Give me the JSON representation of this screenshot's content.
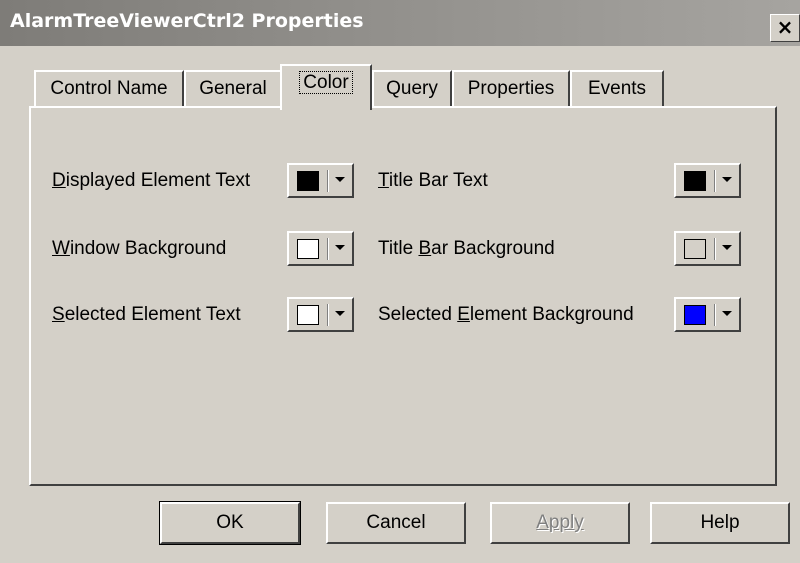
{
  "window": {
    "title": "AlarmTreeViewerCtrl2 Properties",
    "close_glyph": "×"
  },
  "tabs": [
    {
      "label": "Control Name",
      "active": false
    },
    {
      "label": "General",
      "active": false
    },
    {
      "label": "Color",
      "active": true
    },
    {
      "label": "Query",
      "active": false
    },
    {
      "label": "Properties",
      "active": false
    },
    {
      "label": "Events",
      "active": false
    }
  ],
  "colors": {
    "displayed_element_text": {
      "label_prefix": "",
      "label_mnemonic": "D",
      "label_rest": "isplayed Element Text",
      "color": "#000000"
    },
    "title_bar_text": {
      "label_prefix": "",
      "label_mnemonic": "T",
      "label_rest": "itle Bar Text",
      "color": "#000000"
    },
    "window_background": {
      "label_prefix": "",
      "label_mnemonic": "W",
      "label_rest": "indow Background",
      "color": "#ffffff"
    },
    "title_bar_background": {
      "label_prefix": "Title ",
      "label_mnemonic": "B",
      "label_rest": "ar Background",
      "color": "#d4d0c8"
    },
    "selected_element_text": {
      "label_prefix": "",
      "label_mnemonic": "S",
      "label_rest": "elected Element Text",
      "color": "#ffffff"
    },
    "selected_element_background": {
      "label_prefix": "Selected ",
      "label_mnemonic": "E",
      "label_rest": "lement Background",
      "color": "#0000ff"
    }
  },
  "buttons": {
    "ok": "OK",
    "cancel": "Cancel",
    "apply": "Apply",
    "help": "Help"
  }
}
